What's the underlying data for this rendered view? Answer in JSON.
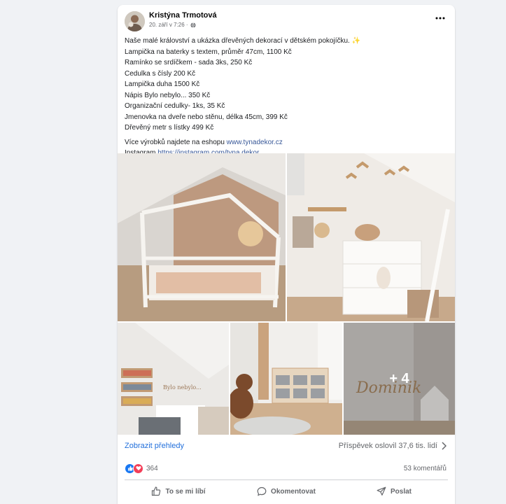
{
  "post": {
    "author": "Kristýna Trmotová",
    "time": "20. září v 7:26 ·",
    "lines": [
      "Naše malé království a ukázka dřevěných dekorací v dětském pokojíčku. ✨",
      "Lampička na baterky s textem, průměr 47cm, 1100 Kč",
      "Ramínko se srdíčkem - sada 3ks, 250 Kč",
      "Cedulka s čísly 200 Kč",
      "Lampička duha 1500 Kč",
      "Nápis Bylo nebylo... 350 Kč",
      "Organizační cedulky- 1ks, 35 Kč",
      "Jmenovka na dveře nebo stěnu, délka 45cm, 399 Kč",
      "Dřevěný metr s lístky 499 Kč"
    ],
    "more_products_prefix": "Více výrobků najdete na eshopu ",
    "eshop_link": "www.tynadekor.cz",
    "instagram_prefix": "Instagram ",
    "instagram_link": "https://instagram.com/tyna.dekor",
    "more_photos": "+ 4"
  },
  "insights": {
    "link": "Zobrazit přehledy",
    "reach": "Příspěvek oslovil 37,6 tis. lidí"
  },
  "reactions": {
    "count": "364",
    "comments": "53 komentářů"
  },
  "actions": {
    "like": "To se mi líbí",
    "comment": "Okomentovat",
    "share": "Poslat"
  },
  "photo_texts": {
    "name_sign": "Dominik",
    "wall_text": "Bylo nebylo..."
  },
  "colors": {
    "link": "#385898",
    "insights_link": "#216fdb",
    "secondary_text": "#65676b",
    "like_blue": "#1877f2",
    "love_red": "#f33e58"
  }
}
